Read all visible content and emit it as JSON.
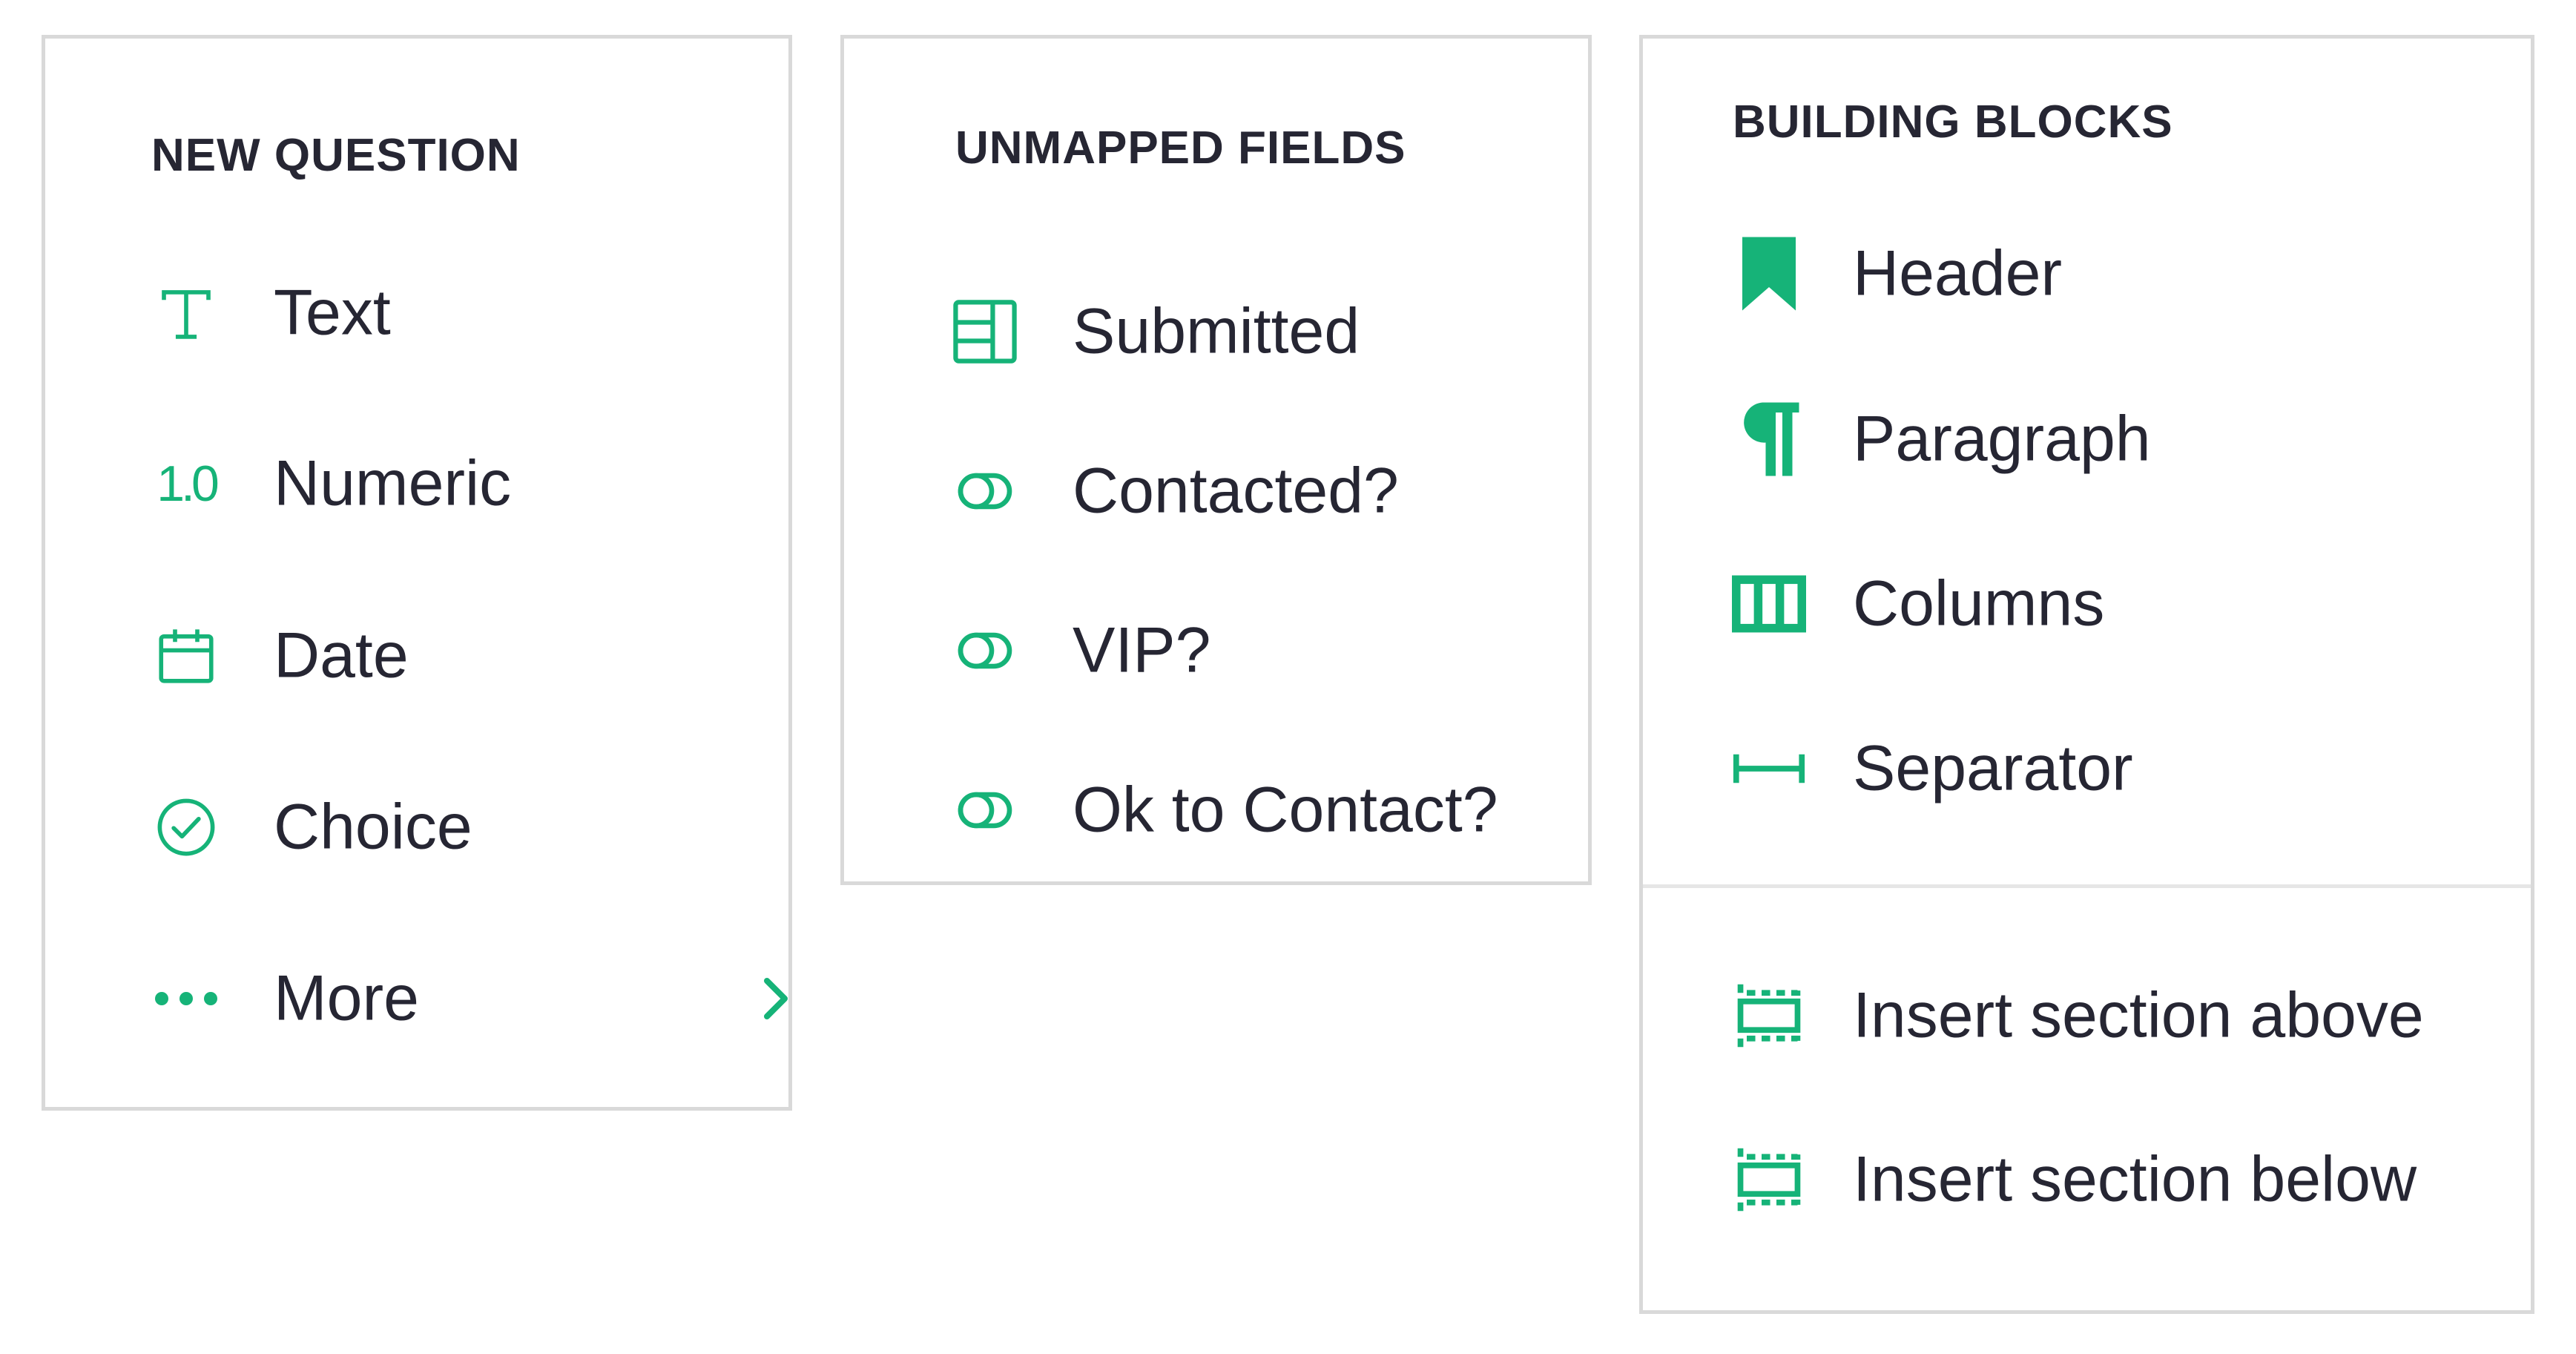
{
  "colors": {
    "accent": "#16b378",
    "text": "#262633",
    "border": "#d9d9d9"
  },
  "new_question": {
    "heading": "NEW QUESTION",
    "items": [
      {
        "label": "Text",
        "icon": "text-icon"
      },
      {
        "label": "Numeric",
        "icon": "numeric-icon",
        "icon_text": "1.0"
      },
      {
        "label": "Date",
        "icon": "calendar-icon"
      },
      {
        "label": "Choice",
        "icon": "check-circle-icon"
      },
      {
        "label": "More",
        "icon": "dots-icon"
      }
    ]
  },
  "unmapped_fields": {
    "heading": "UNMAPPED FIELDS",
    "items": [
      {
        "label": "Submitted",
        "icon": "table-icon"
      },
      {
        "label": "Contacted?",
        "icon": "toggle-icon"
      },
      {
        "label": "VIP?",
        "icon": "toggle-icon"
      },
      {
        "label": "Ok to Contact?",
        "icon": "toggle-icon"
      }
    ]
  },
  "building_blocks": {
    "heading": "BUILDING BLOCKS",
    "items": [
      {
        "label": "Header",
        "icon": "bookmark-icon"
      },
      {
        "label": "Paragraph",
        "icon": "pilcrow-icon"
      },
      {
        "label": "Columns",
        "icon": "columns-icon"
      },
      {
        "label": "Separator",
        "icon": "separator-icon"
      }
    ],
    "section_items": [
      {
        "label": "Insert section above",
        "icon": "insert-section-above-icon"
      },
      {
        "label": "Insert section below",
        "icon": "insert-section-below-icon"
      }
    ]
  }
}
